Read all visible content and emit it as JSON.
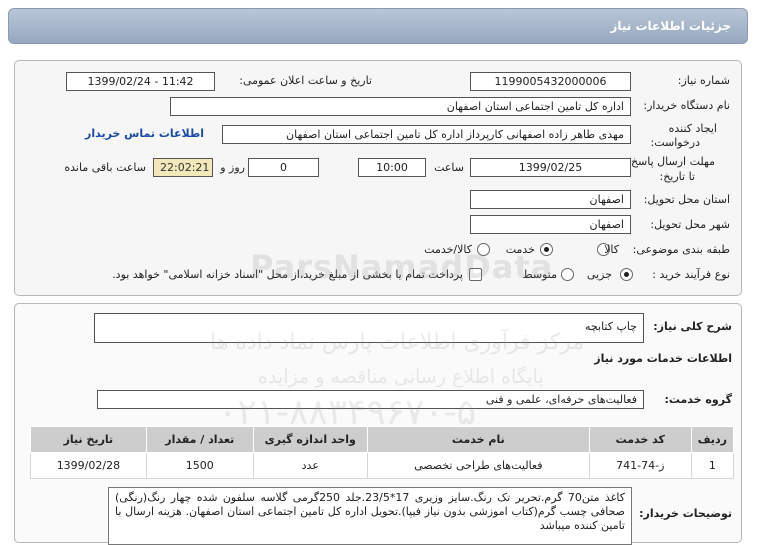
{
  "header": {
    "title": "جزئیات اطلاعات نیاز"
  },
  "form": {
    "need_number_label": "شماره نیاز:",
    "need_number": "1199005432000006",
    "announce_label": "تاریخ و ساعت اعلان عمومی:",
    "announce_value": "1399/02/24 - 11:42",
    "buyer_org_label": "نام دستگاه خریدار:",
    "buyer_org": "اداره کل تامین اجتماعی استان اصفهان",
    "creator_label": "ایجاد کننده درخواست:",
    "creator": "مهدی طاهر زاده اصفهانی کارپرداز اداره کل تامین اجتماعی استان اصفهان",
    "contact_link": "اطلاعات تماس خریدار",
    "deadline_label": "مهلت ارسال پاسخ: تا تاریخ:",
    "deadline_date": "1399/02/25",
    "hour_label": "ساعت",
    "deadline_time": "10:00",
    "day_label": "روز و",
    "days": "0",
    "remaining_time": "22:02:21",
    "remaining_label": "ساعت باقی مانده",
    "province_label": "استان محل تحویل:",
    "province": "اصفهان",
    "city_label": "شهر محل تحویل:",
    "city": "اصفهان",
    "category_label": "طبقه بندی موضوعی:",
    "category_options": [
      "کالا",
      "خدمت",
      "کالا/خدمت"
    ],
    "category_selected": "خدمت",
    "process_label": "نوع فرآیند خرید :",
    "process_options": [
      "جزیی",
      "متوسط"
    ],
    "process_selected": "جزیی",
    "payment_note": "پرداخت تمام یا بخشی از مبلغ خرید،از محل \"اسناد خزانه اسلامی\" خواهد بود."
  },
  "need": {
    "summary_label": "شرح کلی نیاز:",
    "summary": "چاپ کتابچه",
    "services_heading": "اطلاعات خدمات مورد نیاز",
    "service_group_label": "گروه خدمت:",
    "service_group": "فعالیت‌های حرفه‌ای، علمی و فنی",
    "table": {
      "headers": [
        "ردیف",
        "کد خدمت",
        "نام خدمت",
        "واحد اندازه گیری",
        "تعداد / مقدار",
        "تاریخ نیاز"
      ],
      "rows": [
        [
          "1",
          "ز-74-741",
          "فعالیت‌های طراحی تخصصی",
          "عدد",
          "1500",
          "1399/02/28"
        ]
      ]
    },
    "buyer_notes_label": "توضیحات خریدار:",
    "buyer_notes": "کاغذ متن70 گرم.تحریر تک رنگ.سایز وزیری 17*23/5.جلد 250گرمی گلاسه سلفون شده چهار رنگ(رنگی) صحافی چسب گرم(کتاب اموزشی بدون نیاز فیپا).تحویل اداره کل تامین اجتماعی استان اصفهان. هزینه ارسال با تامین کننده میباشد"
  },
  "watermark": {
    "latin": "ParsNamadData",
    "line1": "مرکز فرآوری اطلاعات پارس نماد داده ها",
    "line2": "پایگاه اطلاع رسانی مناقصه و مزایده",
    "phone": "۰۲۱-۸۸۳۴۹۶۷۰-۵"
  },
  "colors": {
    "header_bg": "#a7b6ca",
    "link": "#1a4aa8",
    "timer_bg": "#f2e8b9",
    "table_header": "#cdcdcd"
  }
}
